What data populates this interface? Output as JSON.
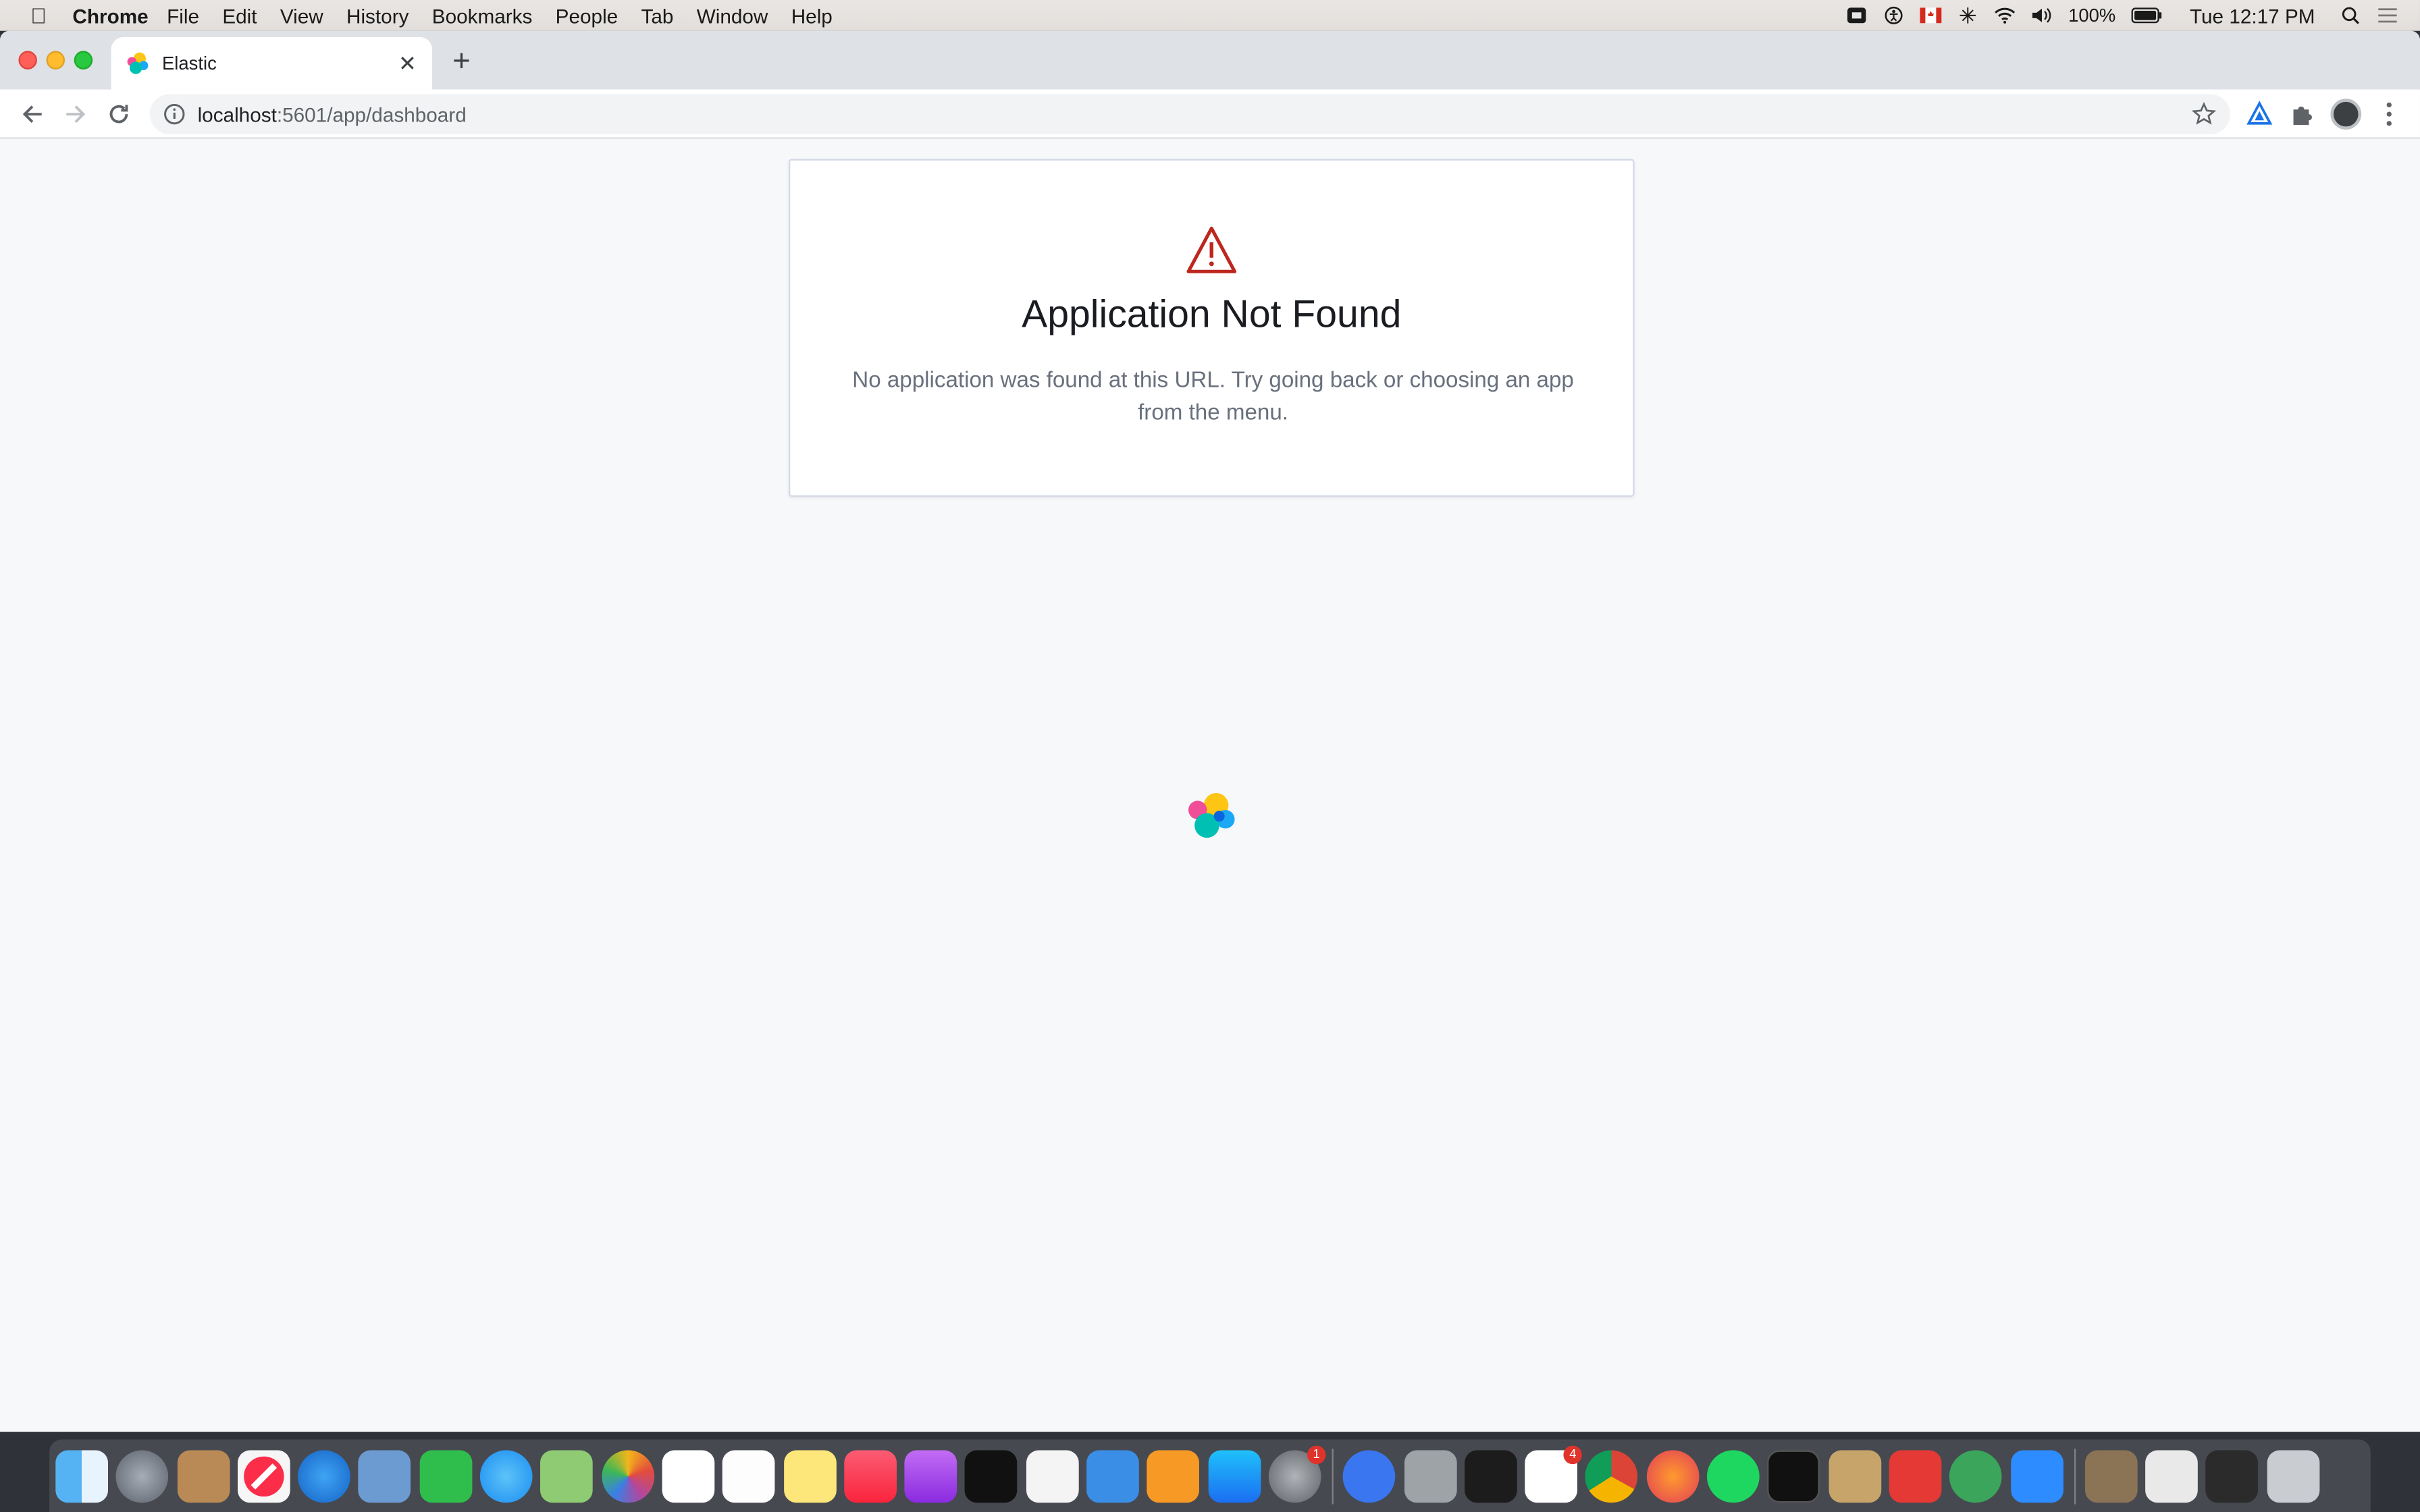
{
  "menubar": {
    "app_name": "Chrome",
    "items": [
      "File",
      "Edit",
      "View",
      "History",
      "Bookmarks",
      "People",
      "Tab",
      "Window",
      "Help"
    ],
    "battery": "100%",
    "clock": "Tue 12:17 PM"
  },
  "browser": {
    "tab_title": "Elastic",
    "url_host": "localhost",
    "url_path": ":5601/app/dashboard"
  },
  "error_card": {
    "title": "Application Not Found",
    "message": "No application was found at this URL. Try going back or choosing an app from the menu.",
    "icon": "warning-icon",
    "accent_color": "#bd271e"
  },
  "dock": {
    "badges": {
      "system_preferences": "1",
      "slack": "4"
    }
  }
}
